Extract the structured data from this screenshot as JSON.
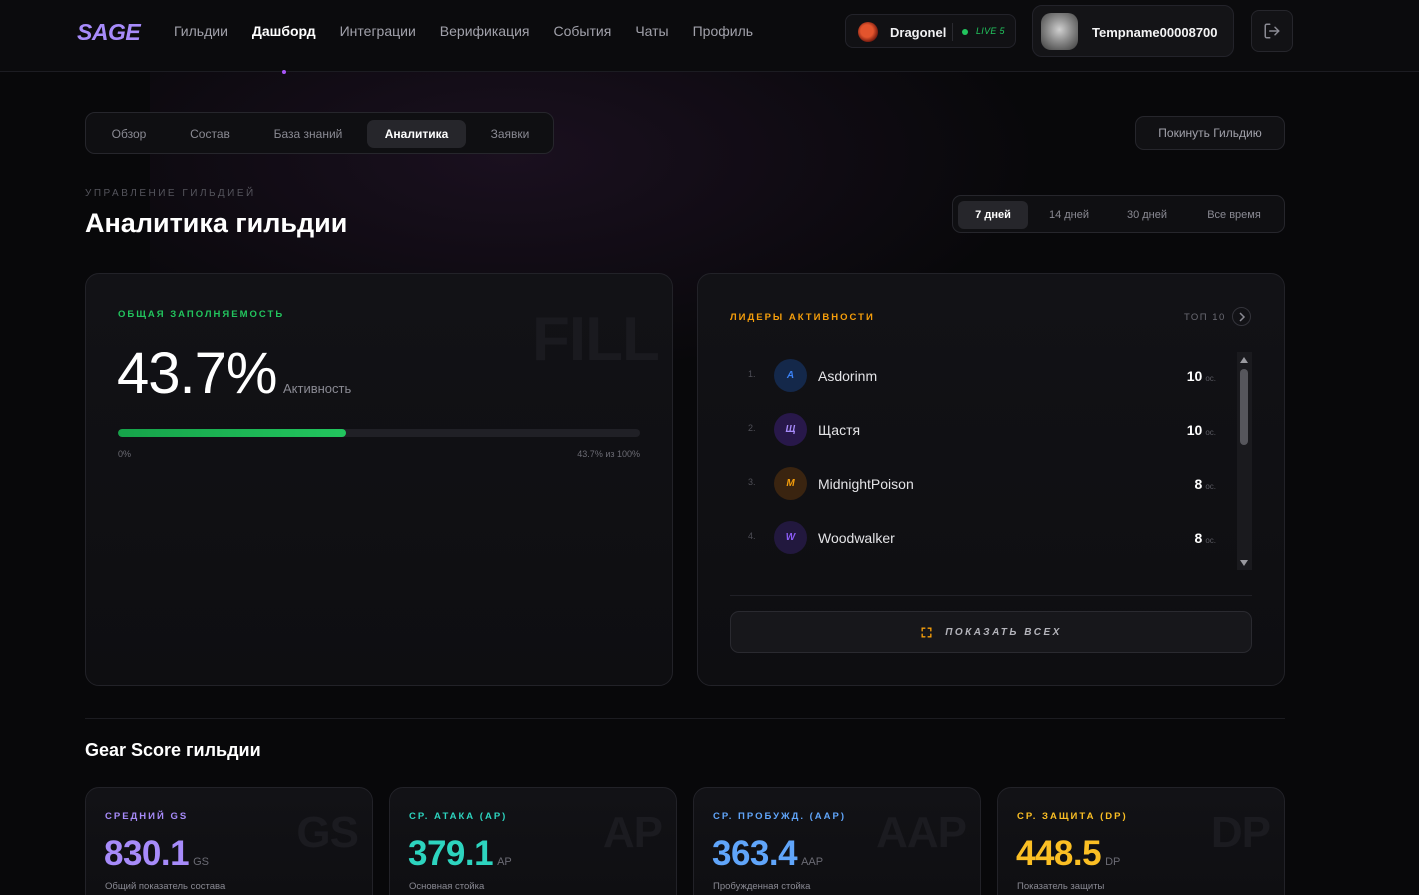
{
  "brand": {
    "logo": "SAGE"
  },
  "nav": {
    "items": [
      {
        "label": "Гильдии"
      },
      {
        "label": "Дашборд",
        "active": true
      },
      {
        "label": "Интеграции"
      },
      {
        "label": "Верификация"
      },
      {
        "label": "События"
      },
      {
        "label": "Чаты"
      },
      {
        "label": "Профиль"
      }
    ]
  },
  "server": {
    "name": "Dragonel",
    "status": "LIVE 5"
  },
  "user": {
    "name": "Tempname00008700"
  },
  "tabs": [
    {
      "label": "Обзор"
    },
    {
      "label": "Состав"
    },
    {
      "label": "База знаний"
    },
    {
      "label": "Аналитика",
      "active": true
    },
    {
      "label": "Заявки"
    }
  ],
  "leave_button": "Покинуть Гильдию",
  "header": {
    "eyebrow": "УПРАВЛЕНИЕ ГИЛЬДИЕЙ",
    "title": "Аналитика гильдии"
  },
  "periods": [
    {
      "label": "7 дней",
      "active": true
    },
    {
      "label": "14 дней"
    },
    {
      "label": "30 дней"
    },
    {
      "label": "Все время"
    }
  ],
  "fill_card": {
    "label": "ОБЩАЯ ЗАПОЛНЯЕМОСТЬ",
    "watermark": "FILL",
    "value": "43.7%",
    "value_label": "Активность",
    "progress_percent": 43.7,
    "min_label": "0%",
    "max_label": "43.7% из 100%"
  },
  "leaders_card": {
    "label": "ЛИДЕРЫ АКТИВНОСТИ",
    "top_label": "ТОП 10",
    "unit": "ос.",
    "show_all": "ПОКАЗАТЬ ВСЕХ",
    "leaders": [
      {
        "rank": "1.",
        "initial": "A",
        "name": "Asdorinm",
        "score": "10"
      },
      {
        "rank": "2.",
        "initial": "Щ",
        "name": "Щастя",
        "score": "10"
      },
      {
        "rank": "3.",
        "initial": "M",
        "name": "MidnightPoison",
        "score": "8"
      },
      {
        "rank": "4.",
        "initial": "W",
        "name": "Woodwalker",
        "score": "8"
      }
    ]
  },
  "gear_score": {
    "title": "Gear Score гильдии",
    "stats": [
      {
        "label": "СРЕДНИЙ GS",
        "watermark": "GS",
        "value": "830.1",
        "unit": "GS",
        "desc": "Общий показатель состава",
        "color": "#a78bfa"
      },
      {
        "label": "СР. АТАКА (AP)",
        "watermark": "AP",
        "value": "379.1",
        "unit": "AP",
        "desc": "Основная стойка",
        "color": "#2dd4bf"
      },
      {
        "label": "СР. ПРОБУЖД. (AAP)",
        "watermark": "AAP",
        "value": "363.4",
        "unit": "AAP",
        "desc": "Пробужденная стойка",
        "color": "#60a5fa"
      },
      {
        "label": "СР. ЗАЩИТА (DP)",
        "watermark": "DP",
        "value": "448.5",
        "unit": "DP",
        "desc": "Показатель защиты",
        "color": "#fbbf24"
      }
    ]
  },
  "colors": {
    "accent": "#a78bfa",
    "green": "#22c55e",
    "orange": "#f59e0b"
  }
}
